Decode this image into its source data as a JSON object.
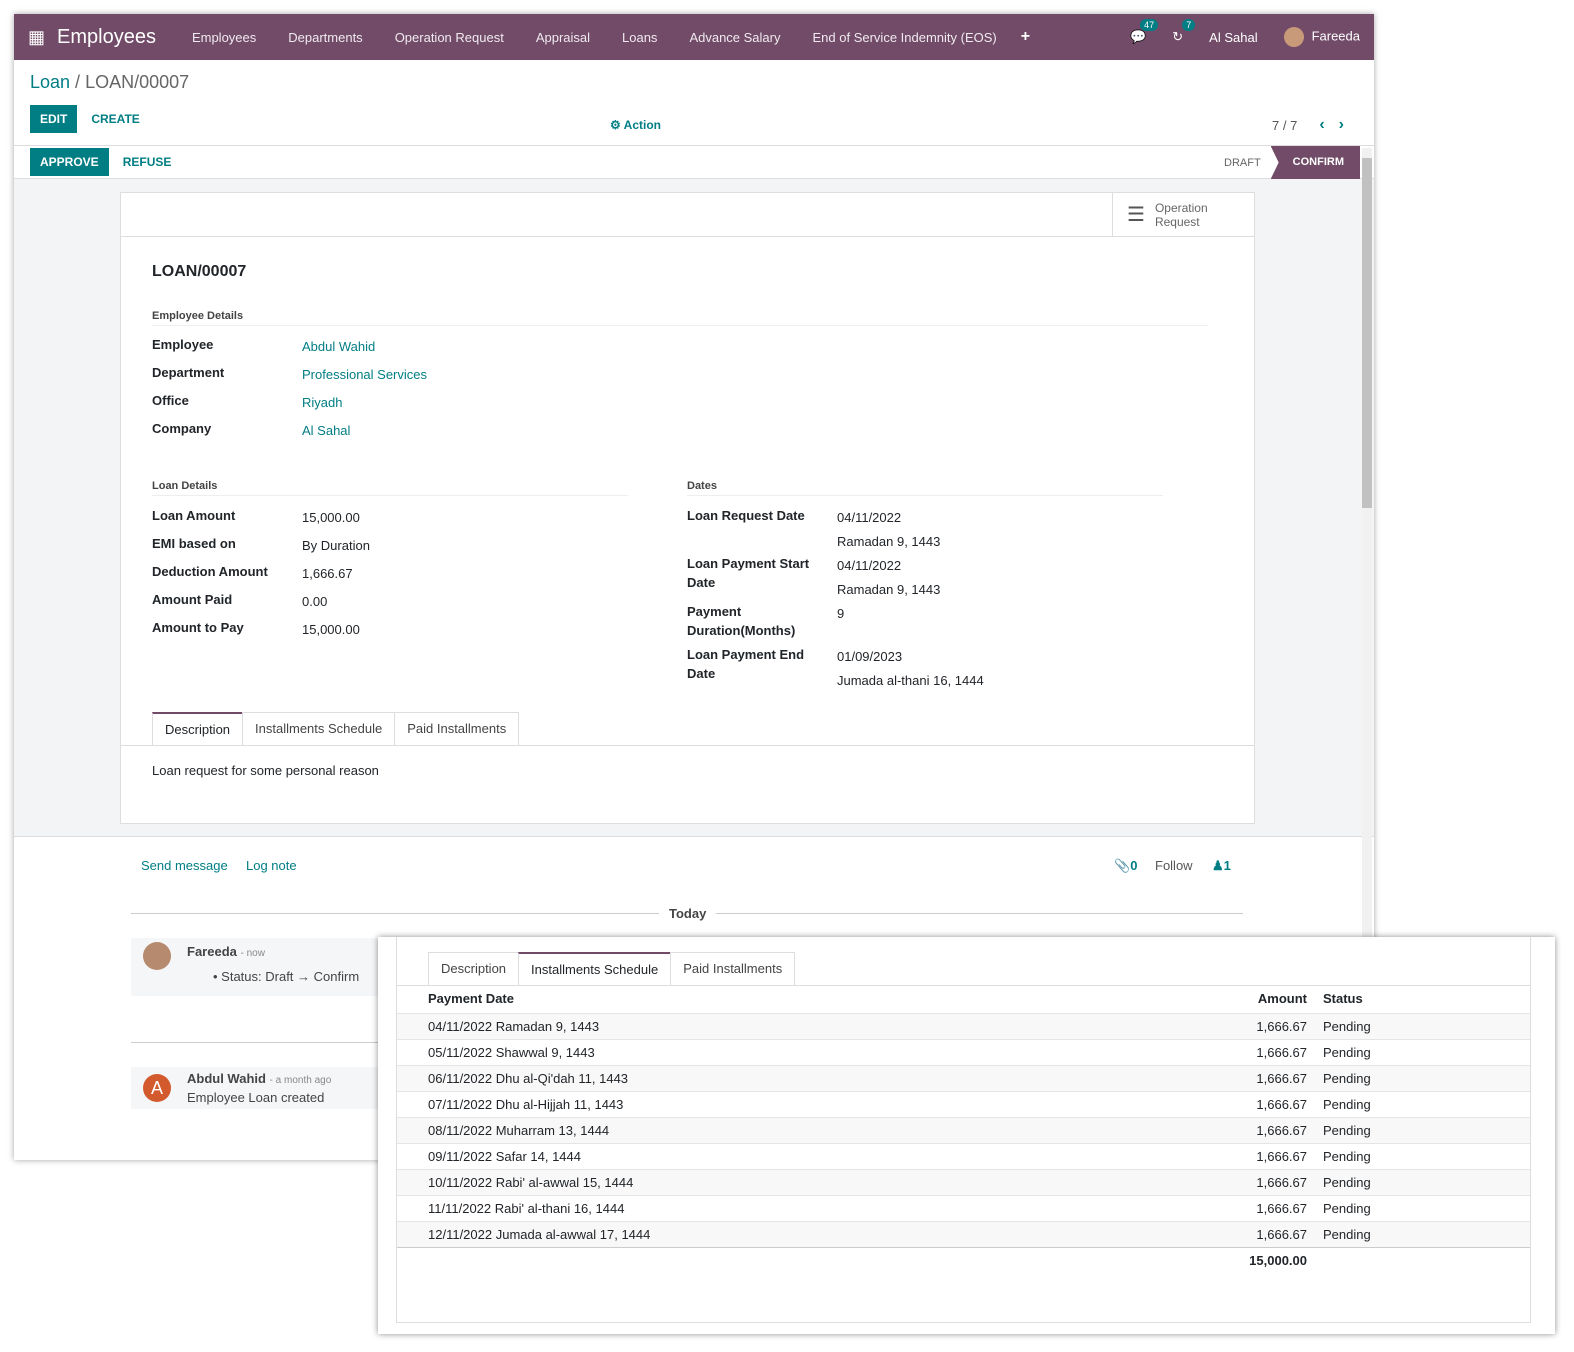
{
  "navbar": {
    "app": "Employees",
    "menu": [
      "Employees",
      "Departments",
      "Operation Request",
      "Appraisal",
      "Loans",
      "Advance Salary",
      "End of Service Indemnity (EOS)"
    ],
    "messages_count": "47",
    "activities_count": "7",
    "company": "Al Sahal",
    "user": "Fareeda",
    "brand_color": "#714B67"
  },
  "breadcrumb": {
    "parent": "Loan",
    "current": "LOAN/00007"
  },
  "toolbar": {
    "edit": "EDIT",
    "create": "CREATE",
    "action": "Action",
    "pager": "7 / 7"
  },
  "statusbar": {
    "approve": "APPROVE",
    "refuse": "REFUSE",
    "stages": [
      "DRAFT",
      "CONFIRM"
    ],
    "active_stage": "CONFIRM"
  },
  "smart_button": {
    "line1": "Operation",
    "line2": "Request"
  },
  "form": {
    "title": "LOAN/00007",
    "employee_section": "Employee Details",
    "employee": [
      {
        "label": "Employee",
        "value": "Abdul Wahid"
      },
      {
        "label": "Department",
        "value": "Professional Services"
      },
      {
        "label": "Office",
        "value": "Riyadh"
      },
      {
        "label": "Company",
        "value": "Al Sahal"
      }
    ],
    "loan_section": "Loan Details",
    "loan": [
      {
        "label": "Loan Amount",
        "value": "15,000.00"
      },
      {
        "label": "EMI based on",
        "value": "By Duration"
      },
      {
        "label": "Deduction Amount",
        "value": "1,666.67"
      },
      {
        "label": "Amount Paid",
        "value": "0.00"
      },
      {
        "label": "Amount to Pay",
        "value": "15,000.00"
      }
    ],
    "dates_section": "Dates",
    "dates": [
      {
        "label": "Loan Request Date",
        "value": "04/11/2022",
        "hijri": "Ramadan 9, 1443"
      },
      {
        "label": "Loan Payment Start Date",
        "value": "04/11/2022",
        "hijri": "Ramadan 9, 1443"
      },
      {
        "label": "Payment Duration(Months)",
        "value": "9",
        "hijri": ""
      },
      {
        "label": "Loan Payment End Date",
        "value": "01/09/2023",
        "hijri": "Jumada al-thani 16, 1444"
      }
    ],
    "tabs": [
      "Description",
      "Installments Schedule",
      "Paid Installments"
    ],
    "description": "Loan request for some personal reason"
  },
  "chatter": {
    "send": "Send message",
    "log": "Log note",
    "attachments": "0",
    "follow": "Follow",
    "followers": "1",
    "today": "Today",
    "messages": [
      {
        "author": "Fareeda",
        "time": "- now",
        "body": "Status: Draft → Confirm"
      },
      {
        "author": "Abdul Wahid",
        "time": "- a month ago",
        "body": "Employee Loan created",
        "initial": "A"
      }
    ]
  },
  "installments": {
    "headers": [
      "Payment Date",
      "Amount",
      "Status"
    ],
    "rows": [
      [
        "04/11/2022 Ramadan 9, 1443",
        "1,666.67",
        "Pending"
      ],
      [
        "05/11/2022 Shawwal 9, 1443",
        "1,666.67",
        "Pending"
      ],
      [
        "06/11/2022 Dhu al-Qi'dah 11, 1443",
        "1,666.67",
        "Pending"
      ],
      [
        "07/11/2022 Dhu al-Hijjah 11, 1443",
        "1,666.67",
        "Pending"
      ],
      [
        "08/11/2022 Muharram 13, 1444",
        "1,666.67",
        "Pending"
      ],
      [
        "09/11/2022 Safar 14, 1444",
        "1,666.67",
        "Pending"
      ],
      [
        "10/11/2022 Rabi' al-awwal 15, 1444",
        "1,666.67",
        "Pending"
      ],
      [
        "11/11/2022 Rabi' al-thani 16, 1444",
        "1,666.67",
        "Pending"
      ],
      [
        "12/11/2022 Jumada al-awwal 17, 1444",
        "1,666.67",
        "Pending"
      ]
    ],
    "total": "15,000.00"
  }
}
